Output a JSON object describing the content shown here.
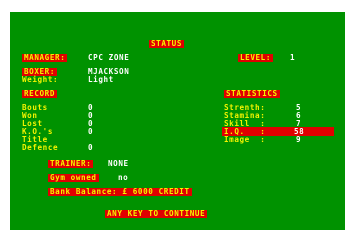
{
  "title": "STATUS",
  "manager": {
    "label": "MANAGER:",
    "value": "CPC ZONE"
  },
  "level": {
    "label": "LEVEL:",
    "value": "1"
  },
  "boxer": {
    "label": "BOXER:",
    "value": "MJACKSON"
  },
  "weight": {
    "label": "Weight:",
    "value": "Light"
  },
  "record": {
    "heading": "RECORD",
    "rows": [
      {
        "label": "Bouts",
        "value": "0"
      },
      {
        "label": "Won",
        "value": "0"
      },
      {
        "label": "Lost",
        "value": "0"
      },
      {
        "label": "K.O.'s",
        "value": "0"
      },
      {
        "label": "Title",
        "value": ""
      },
      {
        "label": "Defence",
        "value": "0"
      }
    ]
  },
  "statistics": {
    "heading": "STATISTICS",
    "rows": [
      {
        "label": "Strenth:",
        "value": "5"
      },
      {
        "label": "Stamina:",
        "value": "6"
      },
      {
        "label": "Skill  :",
        "value": "7"
      },
      {
        "label": "I.Q.   :",
        "value": "58"
      },
      {
        "label": "Image  :",
        "value": "9"
      }
    ]
  },
  "trainer": {
    "label": "TRAINER:",
    "value": "NONE"
  },
  "gym": {
    "label": "Gym owned",
    "value": "no"
  },
  "bank": {
    "label": "Bank Balance: £ 6000 CREDIT"
  },
  "continue_prompt": "ANY KEY TO CONTINUE",
  "colors": {
    "screen_bg": "#009200",
    "highlight": "#e00000",
    "label_yellow": "#f4f400",
    "value_white": "#ffffff"
  }
}
